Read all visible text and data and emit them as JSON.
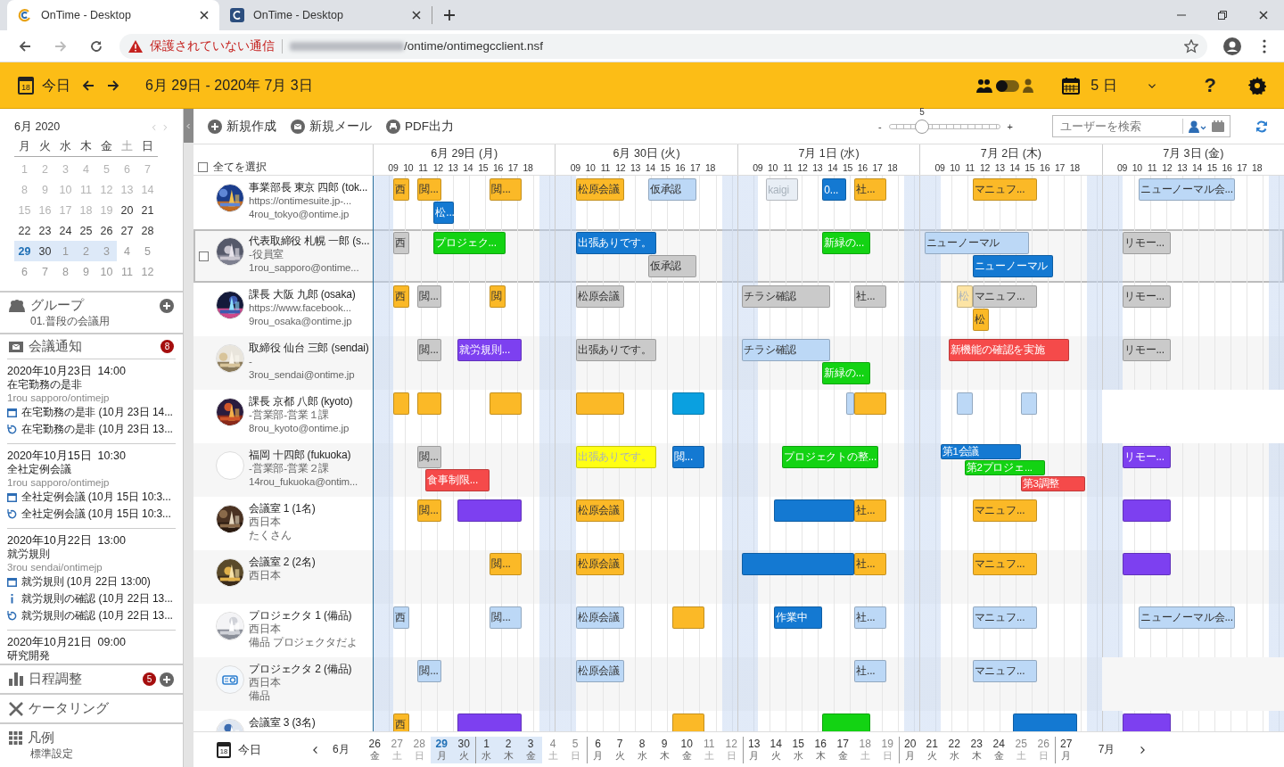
{
  "browser": {
    "tabs": [
      {
        "title": "OnTime - Desktop",
        "selected": true
      },
      {
        "title": "OnTime - Desktop",
        "selected": false
      }
    ],
    "address": {
      "security": "保護されていない通信",
      "path": "/ontime/ontimegcclient.nsf"
    }
  },
  "header": {
    "calendar_day": "18",
    "today": "今日",
    "range": "6月 29日 - 2020年 7月 3日",
    "view_toggle": {
      "on": false
    },
    "days": "5 日",
    "help": "?"
  },
  "sidebar": {
    "calendar": {
      "title": "6月 2020",
      "weekdays": [
        {
          "label": "月",
          "weekend": false
        },
        {
          "label": "火",
          "weekend": false
        },
        {
          "label": "水",
          "weekend": false
        },
        {
          "label": "木",
          "weekend": false
        },
        {
          "label": "金",
          "weekend": false
        },
        {
          "label": "土",
          "weekend": true
        },
        {
          "label": "日",
          "weekend": false
        }
      ],
      "weeks": [
        [
          {
            "label": "1",
            "kind": "past",
            "selected": false
          },
          {
            "label": "2",
            "kind": "past",
            "selected": false
          },
          {
            "label": "3",
            "kind": "past",
            "selected": false
          },
          {
            "label": "4",
            "kind": "past",
            "selected": false
          },
          {
            "label": "5",
            "kind": "past",
            "selected": false
          },
          {
            "label": "6",
            "kind": "past",
            "selected": false
          },
          {
            "label": "7",
            "kind": "past",
            "selected": false
          }
        ],
        [
          {
            "label": "8",
            "kind": "past",
            "selected": false
          },
          {
            "label": "9",
            "kind": "past",
            "selected": false
          },
          {
            "label": "10",
            "kind": "past",
            "selected": false
          },
          {
            "label": "11",
            "kind": "past",
            "selected": false
          },
          {
            "label": "12",
            "kind": "past",
            "selected": false
          },
          {
            "label": "13",
            "kind": "past",
            "selected": false
          },
          {
            "label": "14",
            "kind": "past",
            "selected": false
          }
        ],
        [
          {
            "label": "15",
            "kind": "past",
            "selected": false
          },
          {
            "label": "16",
            "kind": "past",
            "selected": false
          },
          {
            "label": "17",
            "kind": "past",
            "selected": false
          },
          {
            "label": "18",
            "kind": "past",
            "selected": false
          },
          {
            "label": "19",
            "kind": "past",
            "selected": false
          },
          {
            "label": "20",
            "kind": "normal",
            "selected": false
          },
          {
            "label": "21",
            "kind": "normal",
            "selected": false
          }
        ],
        [
          {
            "label": "22",
            "kind": "normal",
            "selected": false
          },
          {
            "label": "23",
            "kind": "normal",
            "selected": false
          },
          {
            "label": "24",
            "kind": "normal",
            "selected": false
          },
          {
            "label": "25",
            "kind": "normal",
            "selected": false
          },
          {
            "label": "26",
            "kind": "normal",
            "selected": false
          },
          {
            "label": "27",
            "kind": "normal",
            "selected": false
          },
          {
            "label": "28",
            "kind": "normal",
            "selected": false
          }
        ],
        [
          {
            "label": "29",
            "kind": "current",
            "selected": true
          },
          {
            "label": "30",
            "kind": "normal",
            "selected": true
          },
          {
            "label": "1",
            "kind": "next",
            "selected": true
          },
          {
            "label": "2",
            "kind": "next",
            "selected": true
          },
          {
            "label": "3",
            "kind": "next",
            "selected": true
          },
          {
            "label": "4",
            "kind": "next",
            "selected": false
          },
          {
            "label": "5",
            "kind": "next",
            "selected": false
          }
        ],
        [
          {
            "label": "6",
            "kind": "next",
            "selected": false
          },
          {
            "label": "7",
            "kind": "next",
            "selected": false
          },
          {
            "label": "8",
            "kind": "next",
            "selected": false
          },
          {
            "label": "9",
            "kind": "next",
            "selected": false
          },
          {
            "label": "10",
            "kind": "next",
            "selected": false
          },
          {
            "label": "11",
            "kind": "next",
            "selected": false
          },
          {
            "label": "12",
            "kind": "next",
            "selected": false
          }
        ]
      ]
    },
    "group": {
      "title": "グループ",
      "subtitle": "01.普段の会議用"
    },
    "notices": {
      "title": "会議通知",
      "badge": "8",
      "items": [
        {
          "date": "2020年10月23日  14:00",
          "subject": "在宅勤務の是非",
          "from": "1rou sapporo/ontimejp",
          "links": [
            {
              "kind": "calendar",
              "text": "在宅勤務の是非 (10月 23日 14..."
            },
            {
              "kind": "reply",
              "text": "在宅勤務の是非 (10月 23日 13..."
            }
          ]
        },
        {
          "date": "2020年10月15日  10:30",
          "subject": "全社定例会議",
          "from": "1rou sapporo/ontimejp",
          "links": [
            {
              "kind": "calendar",
              "text": "全社定例会議 (10月 15日 10:3..."
            },
            {
              "kind": "reply",
              "text": "全社定例会議 (10月 15日 10:3..."
            }
          ]
        },
        {
          "date": "2020年10月22日  13:00",
          "subject": "就労規則",
          "from": "3rou sendai/ontimejp",
          "links": [
            {
              "kind": "calendar",
              "text": "就労規則 (10月 22日 13:00)"
            },
            {
              "kind": "info",
              "text": "就労規則の確認 (10月 22日 13..."
            },
            {
              "kind": "reply",
              "text": "就労規則の確認 (10月 22日 13..."
            }
          ]
        },
        {
          "date": "2020年10月21日  09:00",
          "subject": "研究開発"
        }
      ]
    },
    "sections": [
      {
        "kind": "poll",
        "title": "日程調整",
        "badge": "5",
        "add": true
      },
      {
        "kind": "catering",
        "title": "ケータリング",
        "add": false
      },
      {
        "kind": "legend",
        "title": "凡例",
        "subtitle": "標準設定",
        "add": false
      }
    ]
  },
  "toolbar": {
    "buttons": [
      {
        "kind": "new",
        "label": "新規作成"
      },
      {
        "kind": "mail",
        "label": "新規メール"
      },
      {
        "kind": "print",
        "label": "PDF出力"
      }
    ],
    "zoom": {
      "minus": "-",
      "plus": "+",
      "value": "5",
      "level": 0.3
    },
    "search": {
      "placeholder": "ユーザーを検索"
    }
  },
  "timeline": {
    "select_all": {
      "label": "全てを選択",
      "checked": false
    },
    "days": [
      {
        "label": "6月 29日 (月)",
        "hours": [
          "09",
          "10",
          "11",
          "12",
          "13",
          "14",
          "15",
          "16",
          "17",
          "18"
        ]
      },
      {
        "label": "6月 30日 (火)",
        "hours": [
          "09",
          "10",
          "11",
          "12",
          "13",
          "14",
          "15",
          "16",
          "17",
          "18"
        ]
      },
      {
        "label": "7月 1日 (水)",
        "hours": [
          "09",
          "10",
          "11",
          "12",
          "13",
          "14",
          "15",
          "16",
          "17",
          "18"
        ]
      },
      {
        "label": "7月 2日 (木)",
        "hours": [
          "09",
          "10",
          "11",
          "12",
          "13",
          "14",
          "15",
          "16",
          "17",
          "18"
        ]
      },
      {
        "label": "7月 3日 (金)",
        "hours": [
          "09",
          "10",
          "11",
          "12",
          "13",
          "14",
          "15",
          "16",
          "17",
          "18"
        ]
      }
    ],
    "rows": [
      {
        "lines": [
          "事業部長 東京 四郎 (tok...",
          "https://ontimesuite.jp-...",
          "4rou_tokyo@ontime.jp"
        ],
        "selected": false,
        "days": [
          {
            "lanes": [
              [
                {
                  "label": "西",
                  "color": "#fbb927"
                },
                {
                  "label": "閲...",
                  "color": "#fbb927"
                },
                {
                  "label": "閲...",
                  "color": "#fbb927"
                }
              ],
              [
                {
                  "label": "松...",
                  "color": "#1479d2"
                }
              ]
            ]
          },
          {
            "lanes": [
              [
                {
                  "label": "松原会議",
                  "color": "#fbb927"
                },
                {
                  "label": "仮承認",
                  "color": "#bcd8f6"
                }
              ]
            ]
          },
          {
            "lanes": [
              [
                {
                  "label": "kaigi",
                  "color": "#e8eef5"
                },
                {
                  "label": "0...",
                  "color": "#1479d2"
                },
                {
                  "label": "社...",
                  "color": "#fbb927"
                }
              ]
            ]
          },
          {
            "lanes": [
              [
                {
                  "label": "マニュフ...",
                  "color": "#fbb927"
                }
              ]
            ]
          },
          {
            "lanes": [
              [
                {
                  "label": "ニューノーマル会...",
                  "color": "#bcd8f6"
                }
              ]
            ]
          }
        ]
      },
      {
        "lines": [
          "代表取締役 札幌 一郎 (s...",
          "-役員室",
          "1rou_sapporo@ontime..."
        ],
        "selected": true,
        "days": [
          {
            "lanes": [
              [
                {
                  "label": "西",
                  "color": "#cacaca"
                },
                {
                  "label": "プロジェク...",
                  "color": "#13d313"
                }
              ]
            ]
          },
          {
            "lanes": [
              [
                {
                  "label": "出張ありです。",
                  "color": "#1479d2"
                }
              ],
              [
                {
                  "label": "仮承認",
                  "color": "#cacaca"
                }
              ]
            ]
          },
          {
            "lanes": [
              [
                {
                  "label": "新緑の...",
                  "color": "#13d313"
                }
              ]
            ]
          },
          {
            "lanes": [
              [
                {
                  "label": "ニューノーマル",
                  "color": "#bcd8f6"
                }
              ],
              [
                {
                  "label": "ニューノーマル",
                  "color": "#1479d2"
                }
              ]
            ]
          },
          {
            "lanes": [
              [
                {
                  "label": "リモー...",
                  "color": "#cacaca"
                }
              ]
            ]
          }
        ]
      },
      {
        "lines": [
          "課長 大阪 九郎 (osaka)",
          "https://www.facebook...",
          "9rou_osaka@ontime.jp"
        ],
        "selected": false,
        "days": [
          {
            "lanes": [
              [
                {
                  "label": "西",
                  "color": "#fbb927"
                },
                {
                  "label": "閲...",
                  "color": "#cacaca"
                },
                {
                  "label": "閲",
                  "color": "#fbb927"
                }
              ]
            ]
          },
          {
            "lanes": [
              [
                {
                  "label": "松原会議",
                  "color": "#cacaca"
                }
              ]
            ]
          },
          {
            "lanes": [
              [
                {
                  "label": "チラシ確認",
                  "color": "#cacaca"
                },
                {
                  "label": "社...",
                  "color": "#cacaca"
                }
              ]
            ]
          },
          {
            "lanes": [
              [
                {
                  "label": "松",
                  "color": "#fde4a4"
                },
                {
                  "label": "マニュフ...",
                  "color": "#cacaca"
                }
              ],
              [
                {
                  "label": "松",
                  "color": "#fbb927"
                }
              ]
            ]
          },
          {
            "lanes": [
              [
                {
                  "label": "リモー...",
                  "color": "#cacaca"
                }
              ]
            ]
          }
        ]
      },
      {
        "lines": [
          "取締役 仙台 三郎 (sendai)",
          "-",
          "3rou_sendai@ontime.jp"
        ],
        "selected": false,
        "days": [
          {
            "lanes": [
              [
                {
                  "label": "閲...",
                  "color": "#cacaca"
                },
                {
                  "label": "就労規則...",
                  "color": "#7d40f0"
                }
              ]
            ]
          },
          {
            "lanes": [
              [
                {
                  "label": "出張ありです。",
                  "color": "#cacaca"
                }
              ]
            ]
          },
          {
            "lanes": [
              [
                {
                  "label": "チラシ確認",
                  "color": "#bcd8f6"
                }
              ],
              [
                {
                  "label": "新緑の...",
                  "color": "#13d313"
                }
              ]
            ]
          },
          {
            "lanes": [
              [
                {
                  "label": "新機能の確認を実施",
                  "color": "#f54a4a"
                }
              ]
            ]
          },
          {
            "lanes": [
              [
                {
                  "label": "リモー...",
                  "color": "#cacaca"
                }
              ]
            ]
          }
        ]
      },
      {
        "lines": [
          "課長 京都 八郎 (kyoto)",
          "-営業部-営業１課",
          "8rou_kyoto@ontime.jp"
        ],
        "selected": false,
        "days": [
          {
            "lanes": [
              [
                {
                  "color": "#fbb927"
                },
                {
                  "color": "#fbb927"
                },
                {
                  "color": "#fbb927"
                }
              ]
            ]
          },
          {
            "lanes": [
              [
                {
                  "color": "#fbb927"
                },
                {
                  "color": "#0aa0e0"
                }
              ]
            ]
          },
          {
            "lanes": [
              [
                {
                  "color": "#bcd8f6"
                },
                {
                  "color": "#fbb927"
                }
              ]
            ]
          },
          {
            "lanes": [
              [
                {
                  "color": "#bcd8f6"
                },
                {
                  "color": "#bcd8f6"
                }
              ]
            ]
          }
        ]
      },
      {
        "lines": [
          "福岡 十四郎 (fukuoka)",
          "-営業部-営業２課",
          "14rou_fukuoka@ontim..."
        ],
        "kind": "empty",
        "selected": false,
        "days": [
          {
            "lanes": [
              [
                {
                  "label": "閲...",
                  "color": "#cacaca"
                }
              ],
              [
                {
                  "label": "食事制限...",
                  "color": "#f54a4a"
                }
              ]
            ]
          },
          {
            "lanes": [
              [
                {
                  "label": "出張ありです。",
                  "color": "#ffff14"
                },
                {
                  "label": "閲...",
                  "color": "#1479d2"
                }
              ]
            ]
          },
          {
            "lanes": [
              [
                {
                  "label": "プロジェクトの整...",
                  "color": "#13d313"
                }
              ]
            ]
          },
          {
            "lanes": [
              [
                {
                  "label": "第1会議",
                  "color": "#1479d2"
                }
              ],
              [
                {
                  "label": "第2プロジェ...",
                  "color": "#13d313"
                }
              ],
              [
                {
                  "label": "第3調整",
                  "color": "#f54a4a"
                }
              ]
            ]
          },
          {
            "lanes": [
              [
                {
                  "label": "リモー...",
                  "color": "#7d40f0"
                }
              ]
            ]
          }
        ]
      },
      {
        "lines": [
          "会議室 1 (1名)",
          "西日本",
          "たくさん"
        ],
        "selected": false,
        "days": [
          {
            "lanes": [
              [
                {
                  "label": "閲...",
                  "color": "#fbb927"
                },
                {
                  "color": "#7d40f0"
                }
              ]
            ]
          },
          {
            "lanes": [
              [
                {
                  "label": "松原会議",
                  "color": "#fbb927"
                }
              ]
            ]
          },
          {
            "lanes": [
              [
                {
                  "color": "#1479d2"
                },
                {
                  "label": "社...",
                  "color": "#fbb927"
                }
              ]
            ]
          },
          {
            "lanes": [
              [
                {
                  "label": "マニュフ...",
                  "color": "#fbb927"
                }
              ]
            ]
          },
          {
            "lanes": [
              [
                {
                  "color": "#7d40f0"
                }
              ]
            ]
          }
        ]
      },
      {
        "lines": [
          "会議室 2 (2名)",
          "西日本"
        ],
        "selected": false,
        "days": [
          {
            "lanes": [
              [
                {
                  "label": "閲...",
                  "color": "#fbb927"
                }
              ]
            ]
          },
          {
            "lanes": [
              [
                {
                  "label": "松原会議",
                  "color": "#fbb927"
                }
              ]
            ]
          },
          {
            "lanes": [
              [
                {
                  "color": "#1479d2"
                },
                {
                  "label": "社...",
                  "color": "#fbb927"
                }
              ]
            ]
          },
          {
            "lanes": [
              [
                {
                  "label": "マニュフ...",
                  "color": "#fbb927"
                }
              ]
            ]
          },
          {
            "lanes": [
              [
                {
                  "color": "#7d40f0"
                }
              ]
            ]
          }
        ]
      },
      {
        "lines": [
          "プロジェクタ 1 (備品)",
          "西日本",
          "備品 プロジェクタだよ"
        ],
        "selected": false,
        "days": [
          {
            "lanes": [
              [
                {
                  "label": "西",
                  "color": "#bcd8f6"
                },
                {
                  "label": "閲...",
                  "color": "#bcd8f6"
                }
              ]
            ]
          },
          {
            "lanes": [
              [
                {
                  "label": "松原会議",
                  "color": "#bcd8f6"
                },
                {
                  "color": "#fbb927"
                }
              ]
            ]
          },
          {
            "lanes": [
              [
                {
                  "label": "作業中",
                  "color": "#1479d2"
                },
                {
                  "label": "社...",
                  "color": "#bcd8f6"
                }
              ]
            ]
          },
          {
            "lanes": [
              [
                {
                  "label": "マニュフ...",
                  "color": "#bcd8f6"
                }
              ]
            ]
          },
          {
            "lanes": [
              [
                {
                  "label": "ニューノーマル会...",
                  "color": "#bcd8f6"
                }
              ]
            ]
          }
        ]
      },
      {
        "lines": [
          "プロジェクタ 2 (備品)",
          "西日本",
          "備品"
        ],
        "kind": "icon",
        "selected": false,
        "days": [
          {
            "lanes": [
              [
                {
                  "label": "閲...",
                  "color": "#bcd8f6"
                }
              ]
            ]
          },
          {
            "lanes": [
              [
                {
                  "label": "松原会議",
                  "color": "#bcd8f6"
                }
              ]
            ]
          },
          {
            "lanes": [
              [
                {
                  "label": "社...",
                  "color": "#bcd8f6"
                }
              ]
            ]
          },
          {
            "lanes": [
              [
                {
                  "label": "マニュフ...",
                  "color": "#bcd8f6"
                }
              ]
            ]
          }
        ]
      },
      {
        "lines": [
          "会議室 3 (3名)"
        ],
        "selected": false,
        "days": [
          {
            "lanes": [
              [
                {
                  "label": "西",
                  "color": "#fbb927"
                },
                {
                  "color": "#7d40f0"
                }
              ]
            ]
          },
          {
            "lanes": [
              [
                {
                  "color": "#fbb927"
                }
              ]
            ]
          },
          {
            "lanes": [
              [
                {
                  "color": "#13d313"
                }
              ]
            ]
          },
          {
            "lanes": [
              [
                {
                  "color": "#1479d2"
                }
              ]
            ]
          },
          {
            "lanes": [
              [
                {
                  "color": "#7d40f0"
                }
              ]
            ]
          }
        ]
      }
    ]
  },
  "footer": {
    "calendar_day": "18",
    "today": "今日",
    "month_before": "6月",
    "month_after": "7月",
    "days": [
      {
        "date": "26",
        "weekday": "金",
        "weekend": false,
        "selected": false,
        "current": false,
        "divider": false
      },
      {
        "date": "27",
        "weekday": "土",
        "weekend": true,
        "selected": false,
        "current": false,
        "divider": false
      },
      {
        "date": "28",
        "weekday": "日",
        "weekend": true,
        "selected": false,
        "current": false,
        "divider": false
      },
      {
        "date": "29",
        "weekday": "月",
        "weekend": false,
        "selected": true,
        "current": true,
        "divider": false
      },
      {
        "date": "30",
        "weekday": "火",
        "weekend": false,
        "selected": true,
        "current": false,
        "divider": false
      },
      {
        "date": "1",
        "weekday": "水",
        "weekend": false,
        "selected": true,
        "current": false,
        "divider": true
      },
      {
        "date": "2",
        "weekday": "木",
        "weekend": false,
        "selected": true,
        "current": false,
        "divider": false
      },
      {
        "date": "3",
        "weekday": "金",
        "weekend": false,
        "selected": true,
        "current": false,
        "divider": false
      },
      {
        "date": "4",
        "weekday": "土",
        "weekend": true,
        "selected": false,
        "current": false,
        "divider": false
      },
      {
        "date": "5",
        "weekday": "日",
        "weekend": true,
        "selected": false,
        "current": false,
        "divider": false
      },
      {
        "date": "6",
        "weekday": "月",
        "weekend": false,
        "selected": false,
        "current": false,
        "divider": true
      },
      {
        "date": "7",
        "weekday": "火",
        "weekend": false,
        "selected": false,
        "current": false,
        "divider": false
      },
      {
        "date": "8",
        "weekday": "水",
        "weekend": false,
        "selected": false,
        "current": false,
        "divider": false
      },
      {
        "date": "9",
        "weekday": "木",
        "weekend": false,
        "selected": false,
        "current": false,
        "divider": false
      },
      {
        "date": "10",
        "weekday": "金",
        "weekend": false,
        "selected": false,
        "current": false,
        "divider": false
      },
      {
        "date": "11",
        "weekday": "土",
        "weekend": true,
        "selected": false,
        "current": false,
        "divider": false
      },
      {
        "date": "12",
        "weekday": "日",
        "weekend": true,
        "selected": false,
        "current": false,
        "divider": false
      },
      {
        "date": "13",
        "weekday": "月",
        "weekend": false,
        "selected": false,
        "current": false,
        "divider": true
      },
      {
        "date": "14",
        "weekday": "火",
        "weekend": false,
        "selected": false,
        "current": false,
        "divider": false
      },
      {
        "date": "15",
        "weekday": "水",
        "weekend": false,
        "selected": false,
        "current": false,
        "divider": false
      },
      {
        "date": "16",
        "weekday": "木",
        "weekend": false,
        "selected": false,
        "current": false,
        "divider": false
      },
      {
        "date": "17",
        "weekday": "金",
        "weekend": false,
        "selected": false,
        "current": false,
        "divider": false
      },
      {
        "date": "18",
        "weekday": "土",
        "weekend": true,
        "selected": false,
        "current": false,
        "divider": false
      },
      {
        "date": "19",
        "weekday": "日",
        "weekend": true,
        "selected": false,
        "current": false,
        "divider": false
      },
      {
        "date": "20",
        "weekday": "月",
        "weekend": false,
        "selected": false,
        "current": false,
        "divider": true
      },
      {
        "date": "21",
        "weekday": "火",
        "weekend": false,
        "selected": false,
        "current": false,
        "divider": false
      },
      {
        "date": "22",
        "weekday": "水",
        "weekend": false,
        "selected": false,
        "current": false,
        "divider": false
      },
      {
        "date": "23",
        "weekday": "木",
        "weekend": false,
        "selected": false,
        "current": false,
        "divider": false
      },
      {
        "date": "24",
        "weekday": "金",
        "weekend": false,
        "selected": false,
        "current": false,
        "divider": false
      },
      {
        "date": "25",
        "weekday": "土",
        "weekend": true,
        "selected": false,
        "current": false,
        "divider": false
      },
      {
        "date": "26",
        "weekday": "日",
        "weekend": true,
        "selected": false,
        "current": false,
        "divider": false
      },
      {
        "date": "27",
        "weekday": "月",
        "weekend": false,
        "selected": false,
        "current": false,
        "divider": true
      }
    ]
  }
}
